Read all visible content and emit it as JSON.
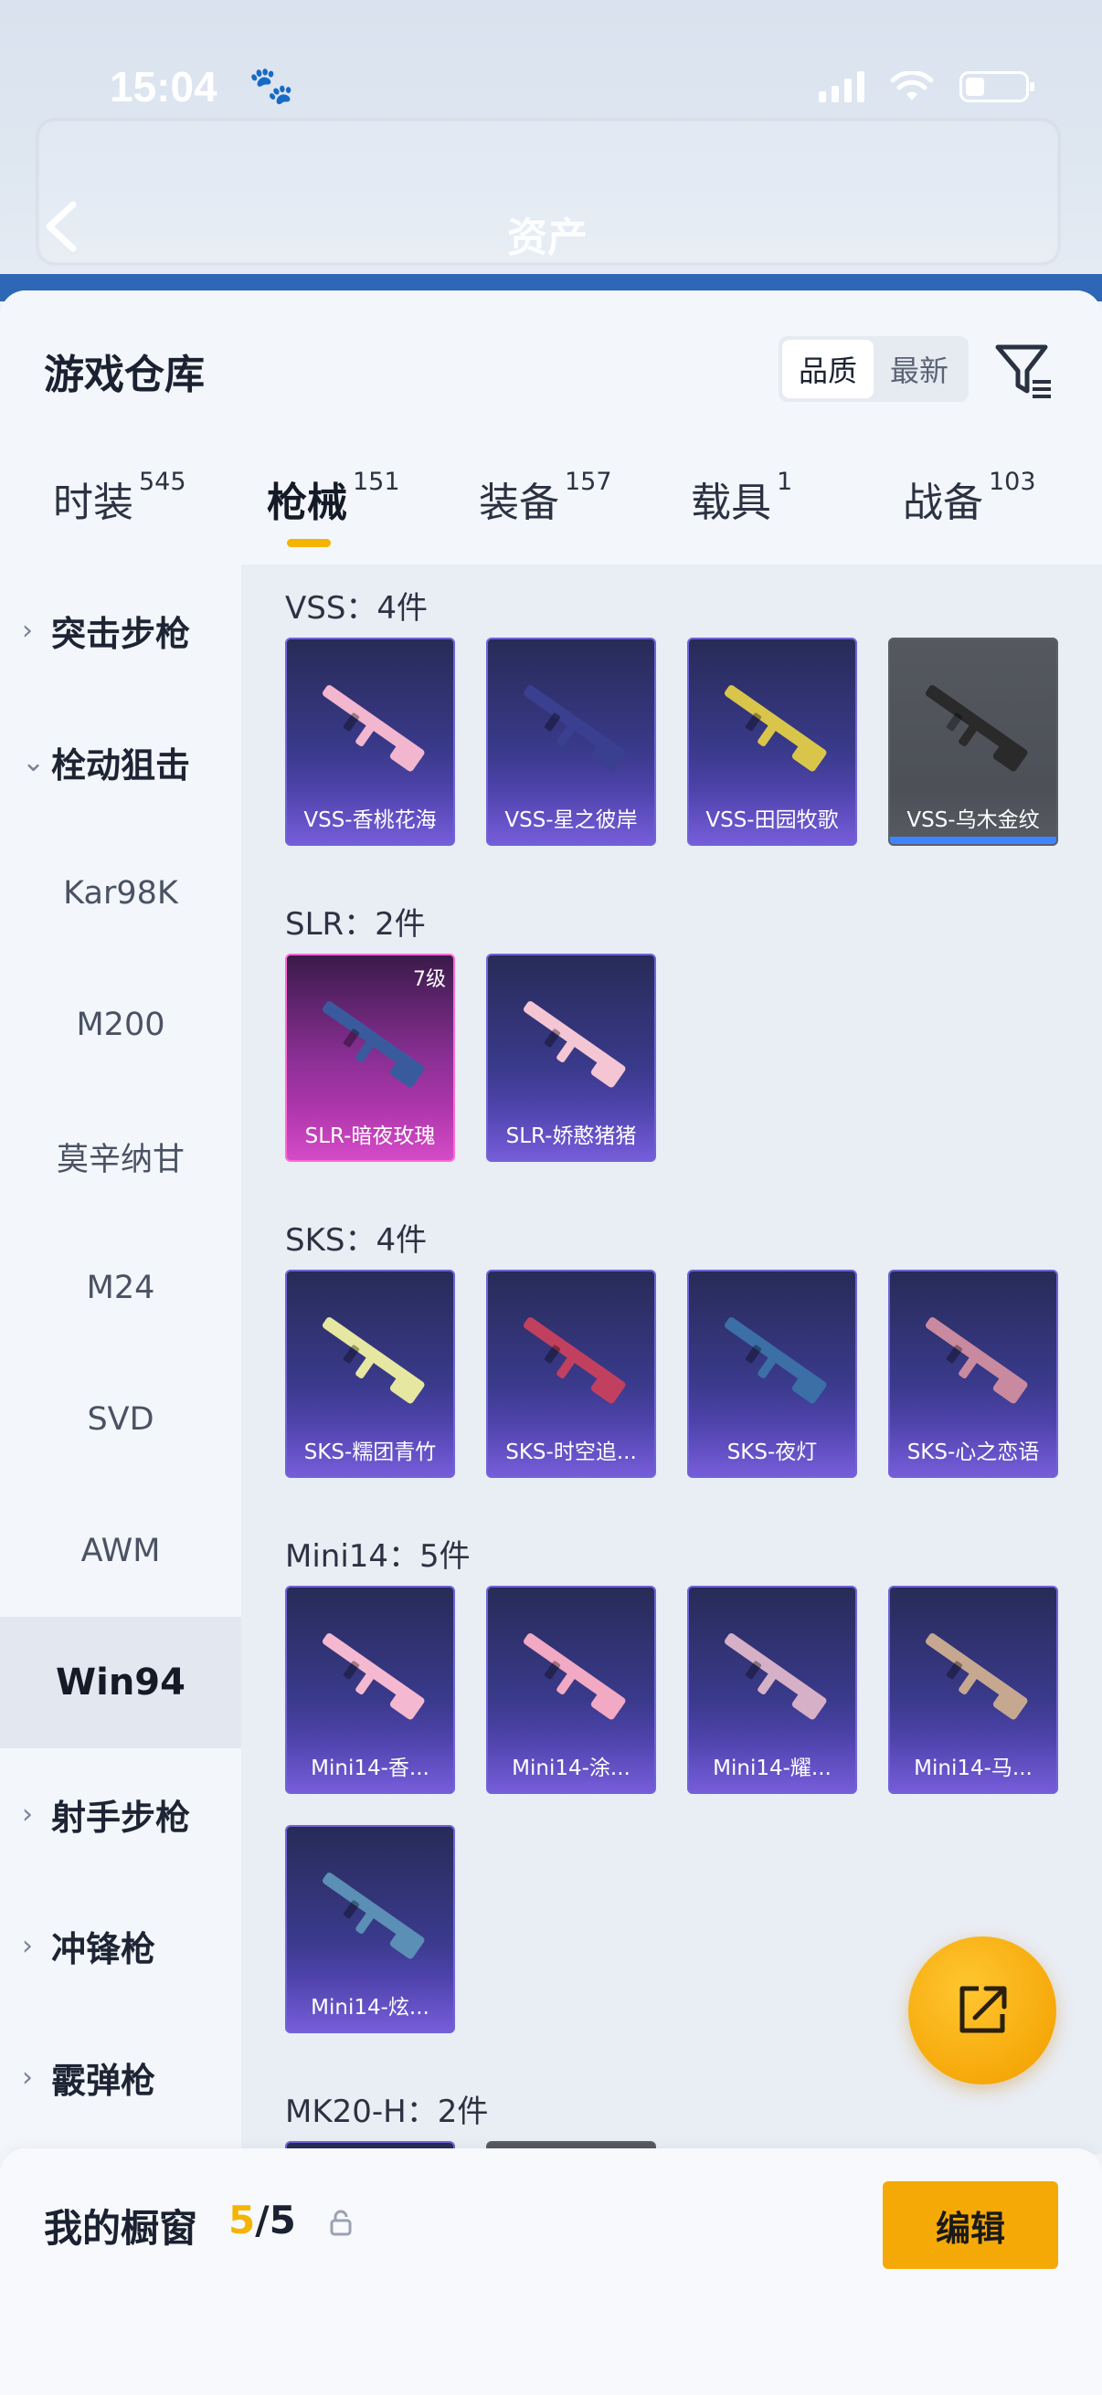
{
  "status_bar": {
    "time": "15:04"
  },
  "nav": {
    "title": "资产"
  },
  "sheet": {
    "title": "游戏仓库",
    "sort_options": [
      "品质",
      "最新"
    ],
    "sort_active": "品质"
  },
  "tabs": [
    {
      "label": "时装",
      "count": "545"
    },
    {
      "label": "枪械",
      "count": "151",
      "active": true
    },
    {
      "label": "装备",
      "count": "157"
    },
    {
      "label": "载具",
      "count": "1"
    },
    {
      "label": "战备",
      "count": "103"
    }
  ],
  "categories": [
    {
      "label": "突击步枪",
      "type": "group",
      "expanded": false
    },
    {
      "label": "栓动狙击",
      "type": "group",
      "expanded": true
    },
    {
      "label": "Kar98K",
      "type": "sub"
    },
    {
      "label": "M200",
      "type": "sub"
    },
    {
      "label": "莫辛纳甘",
      "type": "sub"
    },
    {
      "label": "M24",
      "type": "sub"
    },
    {
      "label": "SVD",
      "type": "sub"
    },
    {
      "label": "AWM",
      "type": "sub"
    },
    {
      "label": "Win94",
      "type": "sub",
      "selected": true
    },
    {
      "label": "射手步枪",
      "type": "group",
      "expanded": false
    },
    {
      "label": "冲锋枪",
      "type": "group",
      "expanded": false
    },
    {
      "label": "霰弹枪",
      "type": "group",
      "expanded": false
    }
  ],
  "sections": [
    {
      "title": "VSS：4件",
      "items": [
        {
          "name": "VSS-香桃花海",
          "style": "purple",
          "gun_color": "#f2b6cf"
        },
        {
          "name": "VSS-星之彼岸",
          "style": "purple",
          "gun_color": "#3b3f8f"
        },
        {
          "name": "VSS-田园牧歌",
          "style": "purple",
          "gun_color": "#d9c54a"
        },
        {
          "name": "VSS-乌木金纹",
          "style": "gray",
          "gun_color": "#2a2a2a"
        }
      ]
    },
    {
      "title": "SLR：2件",
      "items": [
        {
          "name": "SLR-暗夜玫瑰",
          "style": "pink",
          "level": "7级",
          "gun_color": "#3a5a9e"
        },
        {
          "name": "SLR-娇憨猪猪",
          "style": "purple",
          "gun_color": "#f4c6d4"
        }
      ]
    },
    {
      "title": "SKS：4件",
      "items": [
        {
          "name": "SKS-糯团青竹",
          "style": "purple",
          "gun_color": "#e6e7a0"
        },
        {
          "name": "SKS-时空追...",
          "style": "purple",
          "gun_color": "#c2405f"
        },
        {
          "name": "SKS-夜灯",
          "style": "purple",
          "gun_color": "#3b6fa6"
        },
        {
          "name": "SKS-心之恋语",
          "style": "purple",
          "gun_color": "#c98aa0"
        }
      ]
    },
    {
      "title": "Mini14：5件",
      "items": [
        {
          "name": "Mini14-香...",
          "style": "purple",
          "gun_color": "#f4b9d0"
        },
        {
          "name": "Mini14-涂...",
          "style": "purple",
          "gun_color": "#f1a9c4"
        },
        {
          "name": "Mini14-耀...",
          "style": "purple",
          "gun_color": "#d6b0c6"
        },
        {
          "name": "Mini14-马...",
          "style": "purple",
          "gun_color": "#c6a890"
        },
        {
          "name": "Mini14-炫...",
          "style": "purple",
          "gun_color": "#5b8fb5"
        }
      ]
    },
    {
      "title": "MK20-H：2件",
      "items": [
        {
          "name": "",
          "style": "purple",
          "gun_color": "#f4a3c9"
        },
        {
          "name": "",
          "style": "gray",
          "gun_color": "#d7a93a"
        }
      ]
    }
  ],
  "bottom": {
    "label": "我的橱窗",
    "current": "5",
    "total": "/5",
    "edit_label": "编辑"
  },
  "colors": {
    "accent": "#f5b400",
    "card_purple": "#3a3a8c",
    "card_pink": "#d13cc2"
  }
}
